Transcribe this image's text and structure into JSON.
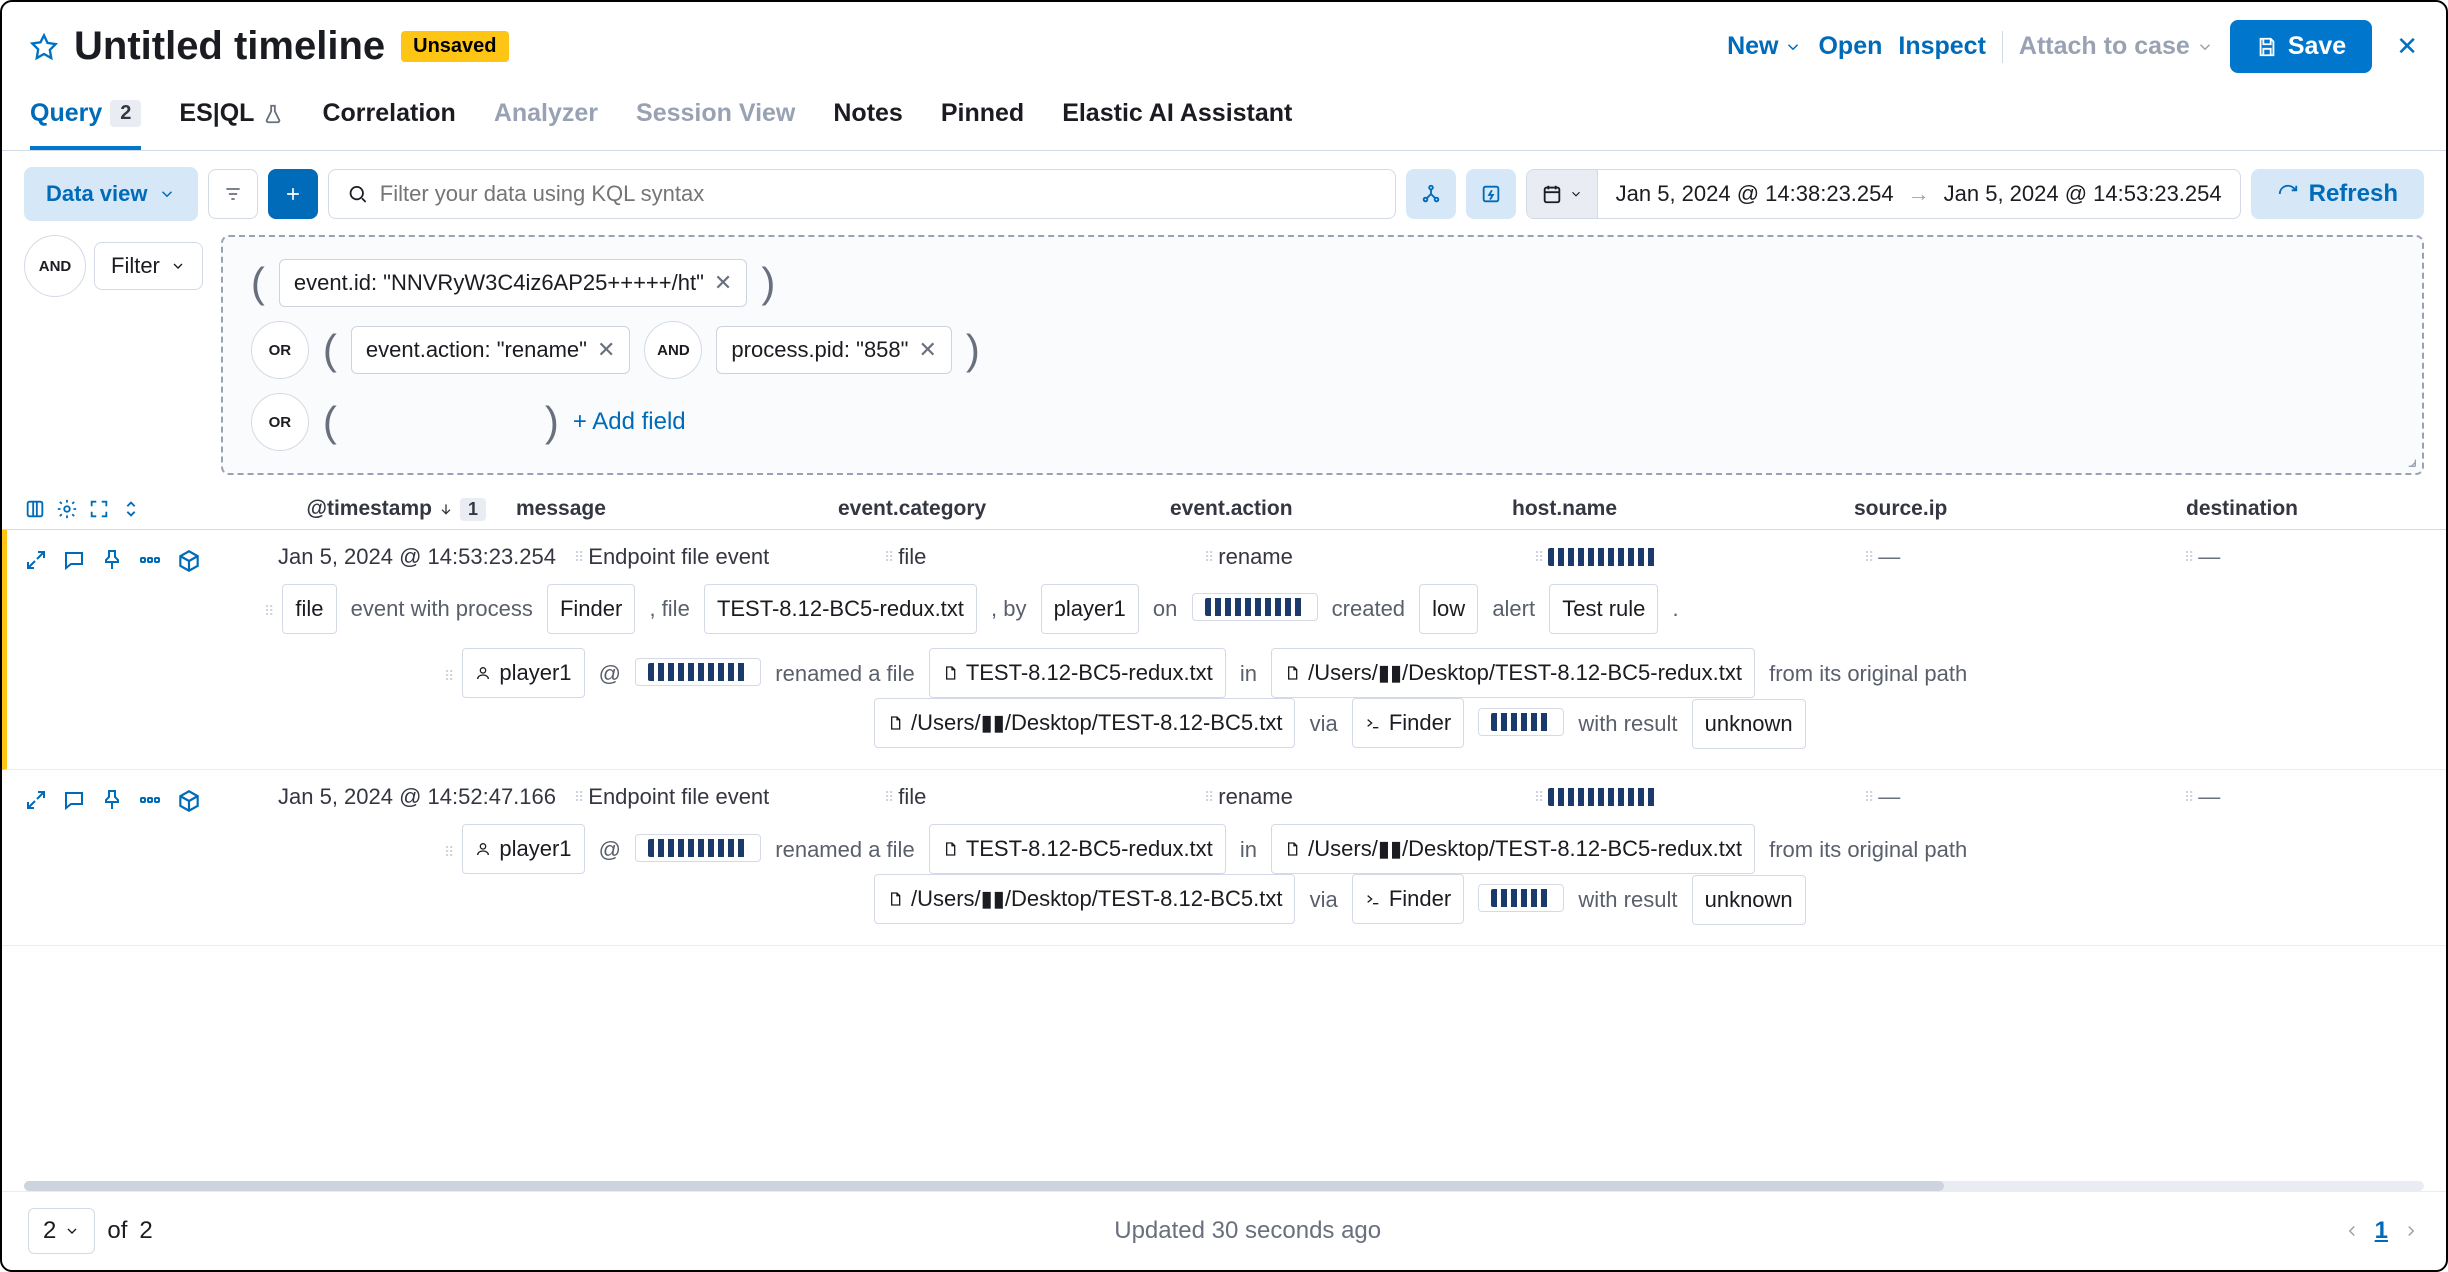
{
  "header": {
    "title": "Untitled timeline",
    "unsaved_badge": "Unsaved",
    "new": "New",
    "open": "Open",
    "inspect": "Inspect",
    "attach": "Attach to case",
    "save": "Save"
  },
  "tabs": {
    "query": "Query",
    "query_count": "2",
    "esql": "ES|QL",
    "correlation": "Correlation",
    "analyzer": "Analyzer",
    "session": "Session View",
    "notes": "Notes",
    "pinned": "Pinned",
    "ai": "Elastic AI Assistant"
  },
  "filters": {
    "data_view": "Data view",
    "kql_placeholder": "Filter your data using KQL syntax",
    "refresh": "Refresh",
    "date_from": "Jan 5, 2024 @ 14:38:23.254",
    "date_to": "Jan 5, 2024 @ 14:53:23.254",
    "and": "AND",
    "or": "OR",
    "filter_label": "Filter",
    "pill1": "event.id: \"NNVRyW3C4iz6AP25+++++/ht\"",
    "pill2": "event.action: \"rename\"",
    "pill3": "process.pid: \"858\"",
    "add_field": "+ Add field"
  },
  "columns": {
    "timestamp": "@timestamp",
    "sort_n": "1",
    "message": "message",
    "category": "event.category",
    "action": "event.action",
    "host": "host.name",
    "source": "source.ip",
    "dest": "destination"
  },
  "rows": [
    {
      "ts": "Jan 5, 2024 @ 14:53:23.254",
      "message": "Endpoint file event",
      "category": "file",
      "action": "rename",
      "host_redacted": true,
      "source": "—",
      "dest": "—",
      "highlight": true,
      "narr1": {
        "file": "file",
        "t1": "event with process",
        "process": "Finder",
        "t2": ", file",
        "fname": "TEST-8.12-BC5-redux.txt",
        "t3": ", by",
        "user": "player1",
        "t4": "on",
        "t5": "created",
        "sev": "low",
        "t6": "alert",
        "rule": "Test rule",
        "t7": "."
      },
      "narr2": {
        "user": "player1",
        "at": "@",
        "t1": "renamed a file",
        "fname": "TEST-8.12-BC5-redux.txt",
        "t2": "in",
        "path1": "/Users/▮▮/Desktop/TEST-8.12-BC5-redux.txt",
        "t3": "from its original path",
        "path2": "/Users/▮▮/Desktop/TEST-8.12-BC5.txt",
        "t4": "via",
        "proc": "Finder",
        "t5": "with result",
        "result": "unknown"
      }
    },
    {
      "ts": "Jan 5, 2024 @ 14:52:47.166",
      "message": "Endpoint file event",
      "category": "file",
      "action": "rename",
      "host_redacted": true,
      "source": "—",
      "dest": "—",
      "highlight": false,
      "narr2": {
        "user": "player1",
        "at": "@",
        "t1": "renamed a file",
        "fname": "TEST-8.12-BC5-redux.txt",
        "t2": "in",
        "path1": "/Users/▮▮/Desktop/TEST-8.12-BC5-redux.txt",
        "t3": "from its original path",
        "path2": "/Users/▮▮/Desktop/TEST-8.12-BC5.txt",
        "t4": "via",
        "proc": "Finder",
        "t5": "with result",
        "result": "unknown"
      }
    }
  ],
  "footer": {
    "page_size": "2",
    "of": "of",
    "total": "2",
    "updated": "Updated 30 seconds ago",
    "page": "1"
  }
}
